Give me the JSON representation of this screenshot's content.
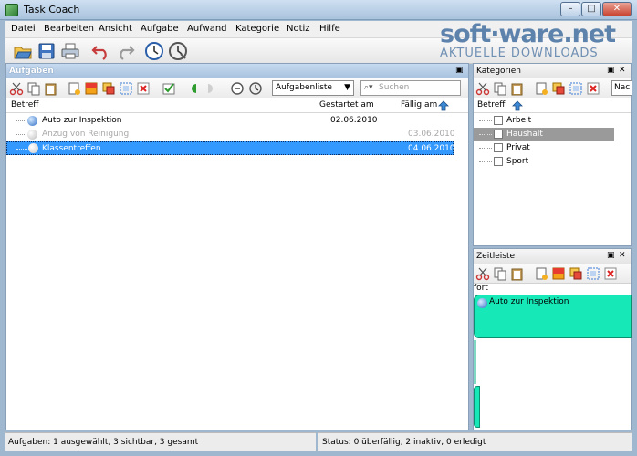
{
  "window": {
    "title": "Task Coach",
    "controls": {
      "minimize": "–",
      "maximize": "□",
      "close": "✕"
    }
  },
  "menu": [
    "Datei",
    "Bearbeiten",
    "Ansicht",
    "Aufgabe",
    "Aufwand",
    "Kategorie",
    "Notiz",
    "Hilfe"
  ],
  "watermark": {
    "line1": "soft·ware.net",
    "line2": "AKTUELLE DOWNLOADS"
  },
  "tasks_panel": {
    "title": "Aufgaben",
    "view_select": "Aufgabenliste",
    "search_placeholder": "Suchen",
    "columns": {
      "subject": "Betreff",
      "started": "Gestartet am",
      "due": "Fällig am"
    },
    "rows": [
      {
        "subject": "Auto zur Inspektion",
        "started": "02.06.2010",
        "due": ""
      },
      {
        "subject": "Anzug von Reinigung",
        "started": "",
        "due": "03.06.2010"
      },
      {
        "subject": "Klassentreffen",
        "started": "",
        "due": "04.06.2010"
      }
    ]
  },
  "categories_panel": {
    "title": "Kategorien",
    "toolbar_more": "Nac",
    "column": "Betreff",
    "items": [
      "Arbeit",
      "Haushalt",
      "Privat",
      "Sport"
    ]
  },
  "timeline_panel": {
    "title": "Zeitleiste",
    "label": "fort",
    "entry": "Auto zur Inspektion"
  },
  "status": {
    "left": "Aufgaben: 1 ausgewählt, 3 sichtbar, 3 gesamt",
    "right": "Status: 0 überfällig, 2 inaktiv, 0 erledigt"
  },
  "colors": {
    "selection": "#3399ff",
    "timeline_bar": "#17e8b8",
    "panel_header": "#a7c1de"
  }
}
